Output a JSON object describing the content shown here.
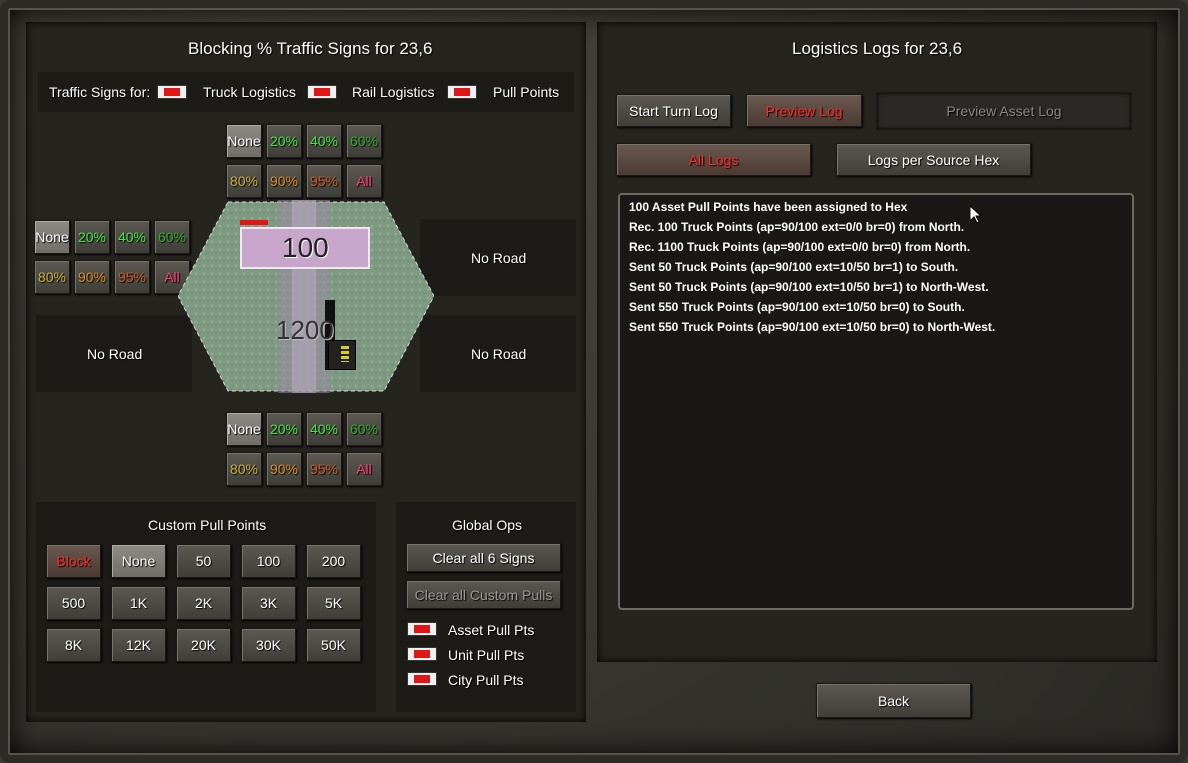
{
  "left": {
    "title": "Blocking % Traffic Signs for 23,6",
    "signs_for": "Traffic Signs for:",
    "legend": [
      "Truck Logistics",
      "Rail Logistics",
      "Pull Points"
    ],
    "sign_buttons": [
      "None",
      "20%",
      "40%",
      "60%",
      "80%",
      "90%",
      "95%",
      "All"
    ],
    "no_road": "No Road",
    "hex": {
      "value_top": "100",
      "value_bottom": "1200"
    }
  },
  "custom_pull": {
    "title": "Custom Pull Points",
    "buttons": [
      "Block",
      "None",
      "50",
      "100",
      "200",
      "500",
      "1K",
      "2K",
      "3K",
      "5K",
      "8K",
      "12K",
      "20K",
      "30K",
      "50K"
    ]
  },
  "global_ops": {
    "title": "Global Ops",
    "clear_signs": "Clear all 6 Signs",
    "clear_pulls": "Clear all Custom Pulls",
    "legend": [
      "Asset Pull Pts",
      "Unit Pull Pts",
      "City Pull Pts"
    ]
  },
  "right": {
    "title": "Logistics Logs for 23,6",
    "start_turn_log": "Start Turn Log",
    "preview_log": "Preview Log",
    "preview_asset_log": "Preview Asset Log",
    "all_logs": "All Logs",
    "logs_per_source": "Logs per Source Hex",
    "log_lines": [
      "100 Asset Pull Points have been assigned to Hex",
      "Rec. 100 Truck Points (ap=90/100 ext=0/0 br=0) from North.",
      "Rec. 1100 Truck Points (ap=90/100 ext=0/0 br=0) from North.",
      "Sent 50 Truck Points (ap=90/100 ext=10/50 br=1) to South.",
      "Sent 50 Truck Points (ap=90/100 ext=10/50 br=1) to North-West.",
      "Sent 550 Truck Points (ap=90/100 ext=10/50 br=0) to South.",
      "Sent 550 Truck Points (ap=90/100 ext=10/50 br=0) to North-West."
    ]
  },
  "back": "Back",
  "colors": {
    "accent_red": "#e01515",
    "pct_green": "#3fe63f",
    "pct_orange": "#d98a2a",
    "pct_pink": "#ff3c7a"
  }
}
